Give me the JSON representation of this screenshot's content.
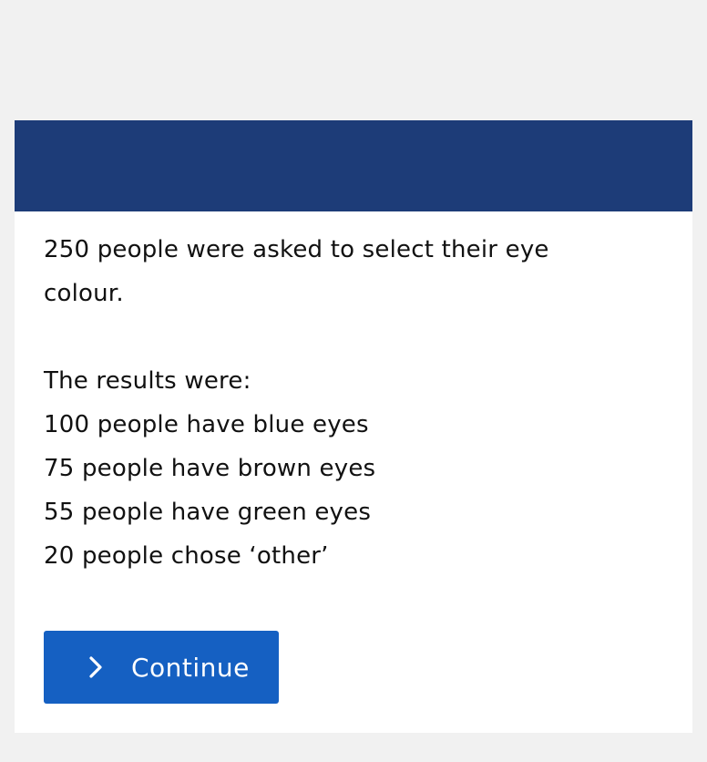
{
  "question": {
    "intro": "250 people were asked to select their eye colour.",
    "results_heading": "The results were:",
    "results": [
      "100 people have blue eyes",
      "75 people have brown eyes",
      "55 people have green eyes",
      "20 people chose ‘other’"
    ]
  },
  "actions": {
    "continue_label": "Continue",
    "continue_icon": "chevron-right-icon"
  },
  "colors": {
    "background": "#f1f1f1",
    "header": "#1d3c78",
    "button": "#1560c2"
  }
}
